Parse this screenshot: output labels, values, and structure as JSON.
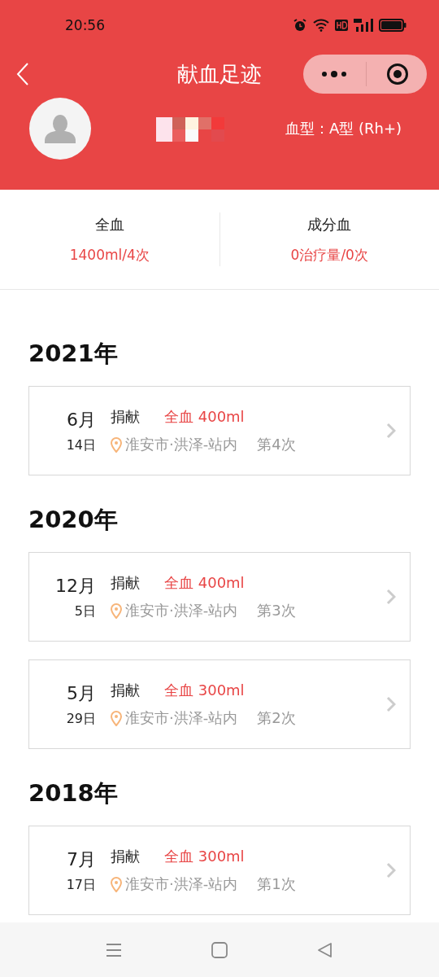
{
  "status_bar": {
    "time": "20:56"
  },
  "nav": {
    "title": "献血足迹"
  },
  "profile": {
    "blood_type": "血型：A型 (Rh+)"
  },
  "summary": [
    {
      "label": "全血",
      "value": "1400ml/4次"
    },
    {
      "label": "成分血",
      "value": "0治疗量/0次"
    }
  ],
  "years": [
    {
      "year": "2021年",
      "records": [
        {
          "month": "6月",
          "day": "14日",
          "action": "捐献",
          "amount": "全血 400ml",
          "place": "淮安市·洪泽-站内",
          "count": "第4次"
        }
      ]
    },
    {
      "year": "2020年",
      "records": [
        {
          "month": "12月",
          "day": "5日",
          "action": "捐献",
          "amount": "全血 400ml",
          "place": "淮安市·洪泽-站内",
          "count": "第3次"
        },
        {
          "month": "5月",
          "day": "29日",
          "action": "捐献",
          "amount": "全血 300ml",
          "place": "淮安市·洪泽-站内",
          "count": "第2次"
        }
      ]
    },
    {
      "year": "2018年",
      "records": [
        {
          "month": "7月",
          "day": "17日",
          "action": "捐献",
          "amount": "全血 300ml",
          "place": "淮安市·洪泽-站内",
          "count": "第1次"
        }
      ]
    }
  ]
}
